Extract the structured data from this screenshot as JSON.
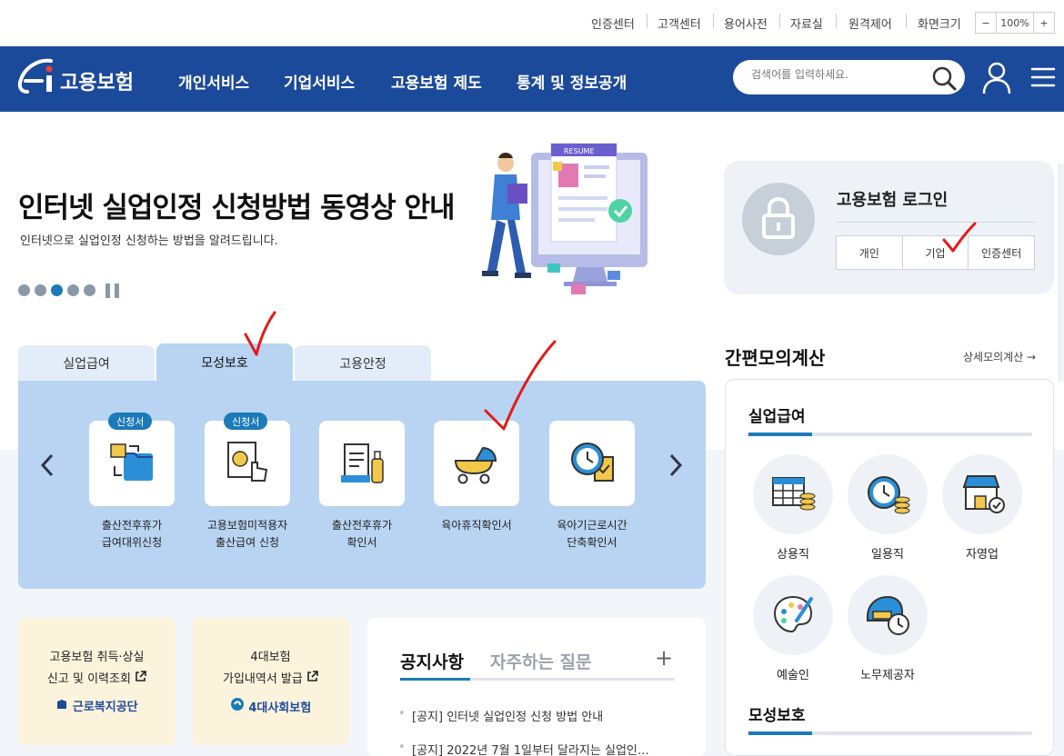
{
  "util_links": [
    "인증센터",
    "고객센터",
    "용어사전",
    "자료실",
    "원격제어",
    "화면크기"
  ],
  "zoom": {
    "minus": "−",
    "value": "100%",
    "plus": "+"
  },
  "header": {
    "logo": "고용보험",
    "nav": [
      "개인서비스",
      "기업서비스",
      "고용보험 제도",
      "통계 및 정보공개"
    ],
    "search_placeholder": "검색어를 입력하세요."
  },
  "hero": {
    "title": "인터넷 실업인정 신청방법 동영상 안내",
    "subtitle": "인터넷으로 실업인정 신청하는 방법을 알려드립니다.",
    "illustration_text": "RESUME",
    "slide_count": 5,
    "active_slide": 3
  },
  "login": {
    "title": "고용보험 로그인",
    "buttons": [
      "개인",
      "기업",
      "인증센터"
    ]
  },
  "tabs": [
    "실업급여",
    "모성보호",
    "고용안정"
  ],
  "active_tab": 1,
  "services": [
    {
      "badge": "신청서",
      "line1": "출산전후휴가",
      "line2": "급여대위신청",
      "icon": "folders-icon"
    },
    {
      "badge": "신청서",
      "line1": "고용보험미적용자",
      "line2": "출산급여 신청",
      "icon": "document-hand-icon"
    },
    {
      "badge": "",
      "line1": "출산전후휴가",
      "line2": "확인서",
      "icon": "document-bottle-icon"
    },
    {
      "badge": "",
      "line1": "육아휴직확인서",
      "line2": "",
      "icon": "stroller-icon"
    },
    {
      "badge": "",
      "line1": "육아기근로시간",
      "line2": "단축확인서",
      "icon": "clock-document-icon"
    }
  ],
  "quick_boxes": [
    {
      "line1": "고용보험 취득·상실",
      "line2": "신고 및 이력조회",
      "org": "근로복지공단"
    },
    {
      "line1": "4대보험",
      "line2": "가입내역서 발급",
      "org": "4대사회보험"
    }
  ],
  "notice": {
    "tabs": [
      "공지사항",
      "자주하는 질문"
    ],
    "more": "+",
    "items": [
      "[공지] 인터넷 실업인정 신청 방법 안내",
      "[공지] 2022년 7월 1일부터 달라지는 실업인…"
    ]
  },
  "calc": {
    "title": "간편모의계산",
    "link": "상세모의계산 →",
    "section1": "실업급여",
    "items": [
      {
        "label": "상용직",
        "icon": "calendar-coins-icon"
      },
      {
        "label": "일용직",
        "icon": "clock-coins-icon"
      },
      {
        "label": "자영업",
        "icon": "store-icon"
      },
      {
        "label": "예술인",
        "icon": "palette-icon"
      },
      {
        "label": "노무제공자",
        "icon": "helmet-clock-icon"
      }
    ],
    "section2": "모성보호"
  },
  "colors": {
    "header": "#1c4a9a",
    "tab_active": "#b8d4f2",
    "accent": "#1c7ab8",
    "annotation": "#e41a1a"
  }
}
